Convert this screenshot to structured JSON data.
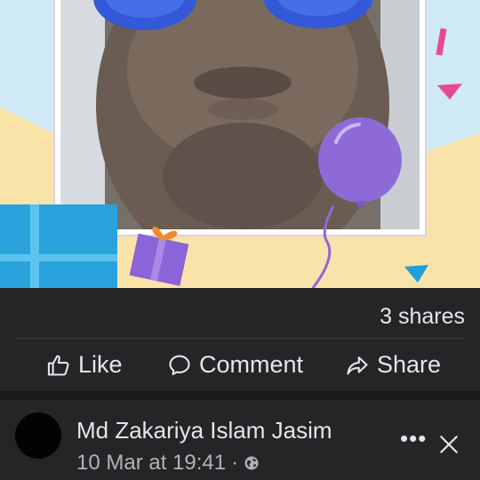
{
  "post": {
    "shares_text": "3 shares",
    "actions": {
      "like_label": "Like",
      "comment_label": "Comment",
      "share_label": "Share"
    },
    "icons": {
      "like": "thumbs-up-icon",
      "comment": "comment-bubble-icon",
      "share": "share-arrow-icon"
    }
  },
  "next_post": {
    "author": "Md Zakariya Islam Jasim",
    "timestamp": "10 Mar at 19:41",
    "separator": "·",
    "privacy_icon": "globe-icon",
    "more_label": "•••",
    "close_icon": "close-icon"
  },
  "colors": {
    "background": "#242526",
    "text": "#e4e6eb",
    "secondary_text": "#b0b3b8",
    "divider": "#3e4042"
  }
}
